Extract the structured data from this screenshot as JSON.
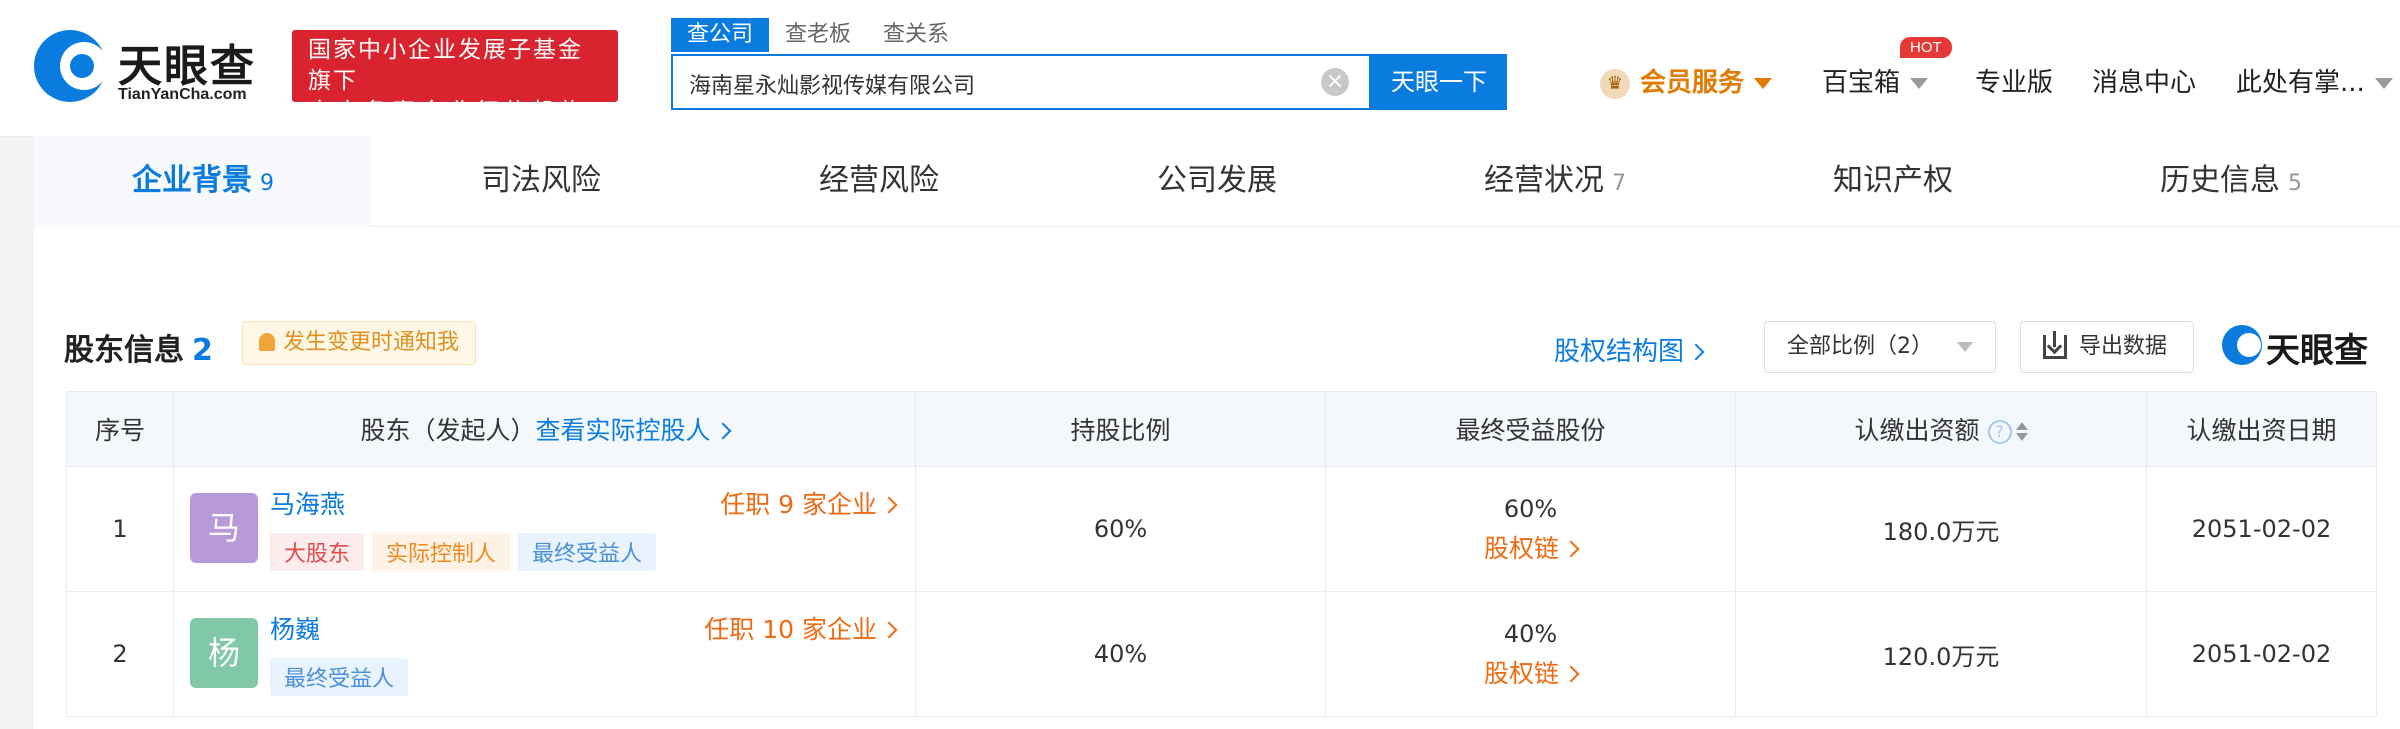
{
  "brand": {
    "logo_cn": "天眼查",
    "logo_en": "TianYanCha.com",
    "badge_line1": "国家中小企业发展子基金旗下",
    "badge_line2": "官方备案企业征信机构"
  },
  "search": {
    "tabs": [
      "查公司",
      "查老板",
      "查关系"
    ],
    "active_tab": 0,
    "query": "海南星永灿影视传媒有限公司",
    "button": "天眼一下"
  },
  "topnav": {
    "vip": "会员服务",
    "toolbox": "百宝箱",
    "hot": "HOT",
    "pro": "专业版",
    "messages": "消息中心",
    "user": "此处有掌..."
  },
  "tabs": [
    {
      "label": "企业背景",
      "count": "9"
    },
    {
      "label": "司法风险",
      "count": ""
    },
    {
      "label": "经营风险",
      "count": ""
    },
    {
      "label": "公司发展",
      "count": ""
    },
    {
      "label": "经营状况",
      "count": "7"
    },
    {
      "label": "知识产权",
      "count": ""
    },
    {
      "label": "历史信息",
      "count": "5"
    }
  ],
  "shareholders": {
    "title": "股东信息",
    "count": "2",
    "notify": "发生变更时通知我",
    "equity_link": "股权结构图",
    "ratio_filter": "全部比例（2）",
    "export": "导出数据",
    "watermark": "天眼查",
    "columns": {
      "index": "序号",
      "shareholder": "股东（发起人）",
      "actual_controller_link": "查看实际控股人",
      "ratio": "持股比例",
      "final_benefit": "最终受益股份",
      "subscribed": "认缴出资额",
      "date": "认缴出资日期"
    },
    "rows": [
      {
        "index": "1",
        "avatar": "马",
        "avatar_color": "#b89ad8",
        "name": "马海燕",
        "jobs": "任职 9 家企业",
        "tags": [
          {
            "text": "大股东",
            "style": "red"
          },
          {
            "text": "实际控制人",
            "style": "orange"
          },
          {
            "text": "最终受益人",
            "style": "blue"
          }
        ],
        "ratio": "60%",
        "final_ratio": "60%",
        "chain": "股权链",
        "amount": "180.0万元",
        "date": "2051-02-02"
      },
      {
        "index": "2",
        "avatar": "杨",
        "avatar_color": "#80c8a8",
        "name": "杨巍",
        "jobs": "任职 10 家企业",
        "tags": [
          {
            "text": "最终受益人",
            "style": "blue"
          }
        ],
        "ratio": "40%",
        "final_ratio": "40%",
        "chain": "股权链",
        "amount": "120.0万元",
        "date": "2051-02-02"
      }
    ]
  }
}
